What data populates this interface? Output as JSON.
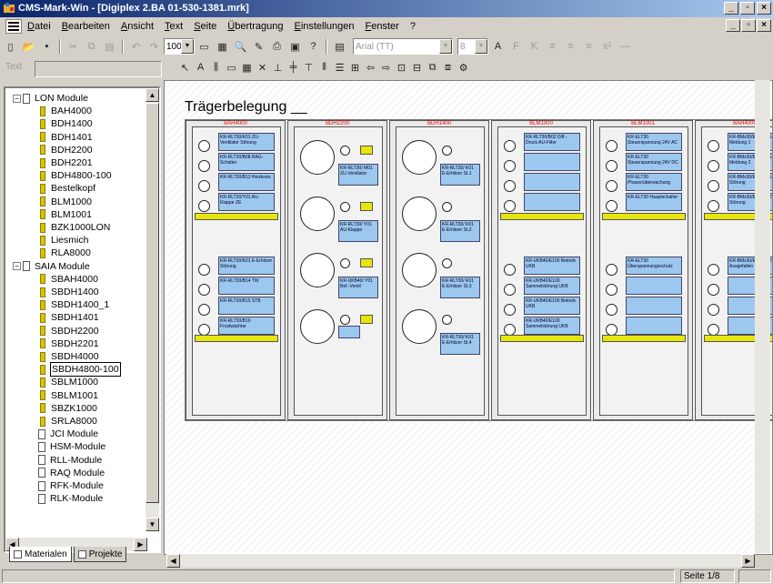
{
  "window": {
    "title": "CMS-Mark-Win - [Digiplex 2.BA 01-530-1381.mrk]"
  },
  "menu": [
    "Datei",
    "Bearbeiten",
    "Ansicht",
    "Text",
    "Seite",
    "Übertragung",
    "Einstellungen",
    "Fenster",
    "?"
  ],
  "toolbar": {
    "zoom": "100",
    "font": "Arial (TT)",
    "size": "8"
  },
  "textbar": {
    "label": "Text"
  },
  "tree": {
    "groups": [
      {
        "label": "LON Module",
        "items": [
          "BAH4000",
          "BDH1400",
          "BDH1401",
          "BDH2200",
          "BDH2201",
          "BDH4800-100",
          "Bestelkopf",
          "BLM1000",
          "BLM1001",
          "BZK1000LON",
          "Liesmich",
          "RLA8000"
        ]
      },
      {
        "label": "SAIA Module",
        "items": [
          "SBAH4000",
          "SBDH1400",
          "SBDH1400_1",
          "SBDH1401",
          "SBDH2200",
          "SBDH2201",
          "SBDH4000",
          "SBDH4800-100",
          "SBLM1000",
          "SBLM1001",
          "SBZK1000",
          "SRLA8000"
        ]
      }
    ],
    "others": [
      "JCI Module",
      "HSM-Module",
      "RLL-Module",
      "RAQ Module",
      "RFK-Module",
      "RLK-Module"
    ],
    "selected": "SBDH4800-100"
  },
  "tabs": [
    "Materialen",
    "Projekte"
  ],
  "document": {
    "title": "Trägerbelegung __"
  },
  "cards": [
    {
      "header": "BAH4000",
      "top": [
        "KR-RLT30/K01 ZU-Ventilator Störung",
        "KR-RLT30/B08 RAG-Schalter",
        "KR-RLT30/B13 Heizkreis",
        "KR-RLT30/Y01 AU-Klappe ZE"
      ],
      "bottom": [
        "KR-RLT30/K01 E-Erhitzer Störung",
        "KR-RLT30/B14 TW",
        "KR-RLT30/B15 STB",
        "KR-RLT30/B16 Frostwächter"
      ]
    },
    {
      "header": "BDH2200",
      "top": [
        "KR-RLT30/ M01 ZU-Ventilator",
        "KR-RLT30/ Y01 AU-Klappe"
      ],
      "bottom": [
        "KR-UKB40/ Y01 Bef.-Ventil"
      ]
    },
    {
      "header": "BDH1400",
      "top": [
        "KR-RLT30/ K01 E-Erhitzer St.1",
        "KR-RLT30/ K01 E-Erhitzer St.2"
      ],
      "bottom": [
        "KR-RLT30/ K01 E-Erhitzer St.3",
        "KR-RLT30/ K01 E-Erhitzer St.4"
      ]
    },
    {
      "header": "BLM1000",
      "top": [
        "KR-RLT30/B02 Diff.-Druck AU-Filter"
      ],
      "bottom": [
        "KR-UKB40/E100 Betrieb UKB",
        "KR-UKB40/E100 Sammelstörung UKB",
        "KR-UKB40/E100 Betrieb UKB",
        "KR-UKB40/E100 Sammelstörung UKB"
      ]
    },
    {
      "header": "BLM1001",
      "top": [
        "KR-ELT30 Steuerspannung 24V AC",
        "KR-ELT30 Steuerspannung 24V DC",
        "KR-ELT30 Phasenüberwachung",
        "KR-ELT30 Hauptschalter"
      ],
      "bottom": [
        "KR-ELT30 Überspannungsschutz"
      ]
    },
    {
      "header": "BAH4000",
      "top": [
        "KR-BMx30/E01 RAG-Meldung 1",
        "KR-BMx30/E01 RAG-Meldung 2",
        "KR-BMx30/E01 RAG 1+2 Störung",
        "KR-BMx30/E01 GMZ Störung"
      ],
      "bottom": [
        "KR-BMx30/E01 GMZ-Ausgefallen"
      ]
    }
  ],
  "status": {
    "page": "Seite 1/8"
  }
}
